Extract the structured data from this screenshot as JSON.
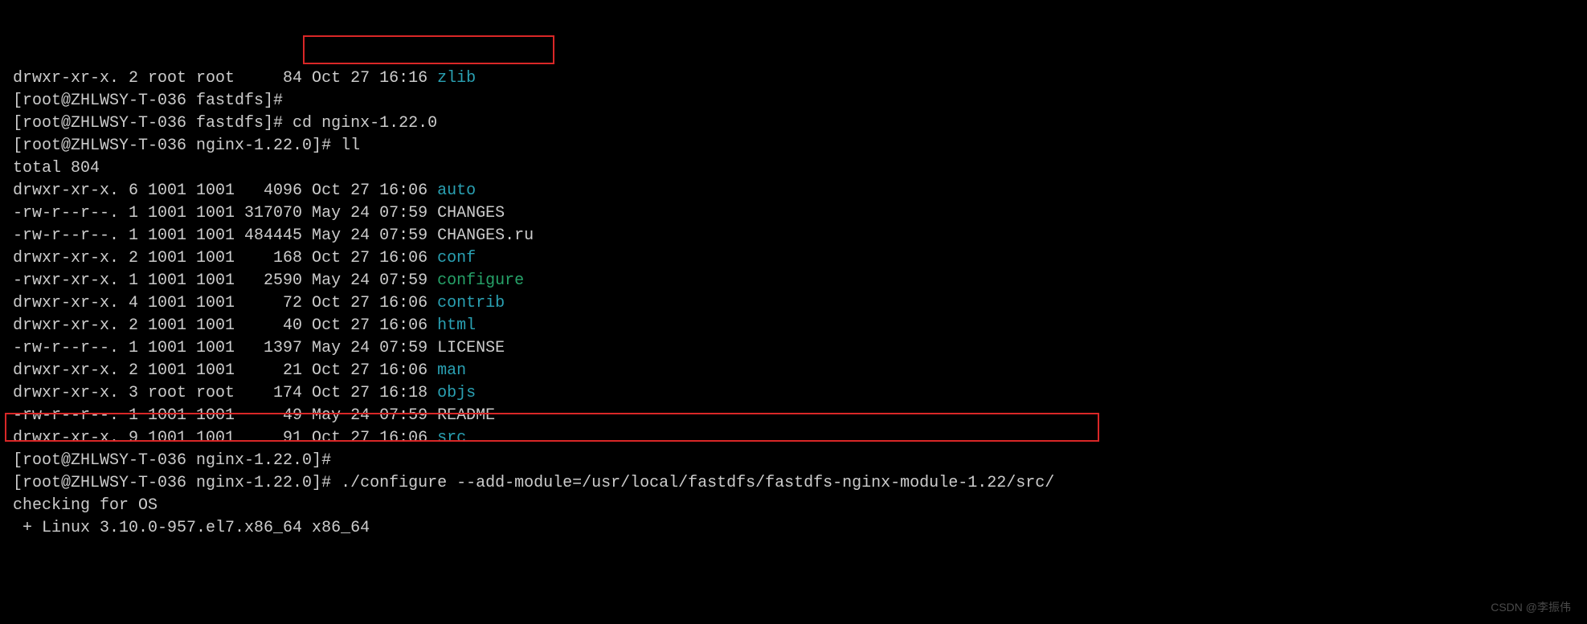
{
  "lines": [
    {
      "segments": [
        {
          "t": "drwxr-xr-x. 2 root root     84 Oct 27 16:16 ",
          "c": "white"
        },
        {
          "t": "zlib",
          "c": "cyan"
        }
      ]
    },
    {
      "segments": [
        {
          "t": "[root@ZHLWSY-T-036 fastdfs]# ",
          "c": "white"
        }
      ]
    },
    {
      "segments": [
        {
          "t": "[root@ZHLWSY-T-036 fastdfs]# cd nginx-1.22.0",
          "c": "white"
        }
      ]
    },
    {
      "segments": [
        {
          "t": "[root@ZHLWSY-T-036 nginx-1.22.0]# ll",
          "c": "white"
        }
      ]
    },
    {
      "segments": [
        {
          "t": "total 804",
          "c": "white"
        }
      ]
    },
    {
      "segments": [
        {
          "t": "drwxr-xr-x. 6 1001 1001   4096 Oct 27 16:06 ",
          "c": "white"
        },
        {
          "t": "auto",
          "c": "cyan"
        }
      ]
    },
    {
      "segments": [
        {
          "t": "-rw-r--r--. 1 1001 1001 317070 May 24 07:59 CHANGES",
          "c": "white"
        }
      ]
    },
    {
      "segments": [
        {
          "t": "-rw-r--r--. 1 1001 1001 484445 May 24 07:59 CHANGES.ru",
          "c": "white"
        }
      ]
    },
    {
      "segments": [
        {
          "t": "drwxr-xr-x. 2 1001 1001    168 Oct 27 16:06 ",
          "c": "white"
        },
        {
          "t": "conf",
          "c": "cyan"
        }
      ]
    },
    {
      "segments": [
        {
          "t": "-rwxr-xr-x. 1 1001 1001   2590 May 24 07:59 ",
          "c": "white"
        },
        {
          "t": "configure",
          "c": "green"
        }
      ]
    },
    {
      "segments": [
        {
          "t": "drwxr-xr-x. 4 1001 1001     72 Oct 27 16:06 ",
          "c": "white"
        },
        {
          "t": "contrib",
          "c": "cyan"
        }
      ]
    },
    {
      "segments": [
        {
          "t": "drwxr-xr-x. 2 1001 1001     40 Oct 27 16:06 ",
          "c": "white"
        },
        {
          "t": "html",
          "c": "cyan"
        }
      ]
    },
    {
      "segments": [
        {
          "t": "-rw-r--r--. 1 1001 1001   1397 May 24 07:59 LICENSE",
          "c": "white"
        }
      ]
    },
    {
      "segments": [
        {
          "t": "drwxr-xr-x. 2 1001 1001     21 Oct 27 16:06 ",
          "c": "white"
        },
        {
          "t": "man",
          "c": "cyan"
        }
      ]
    },
    {
      "segments": [
        {
          "t": "drwxr-xr-x. 3 root root    174 Oct 27 16:18 ",
          "c": "white"
        },
        {
          "t": "objs",
          "c": "cyan"
        }
      ]
    },
    {
      "segments": [
        {
          "t": "-rw-r--r--. 1 1001 1001     49 May 24 07:59 README",
          "c": "white"
        }
      ]
    },
    {
      "segments": [
        {
          "t": "drwxr-xr-x. 9 1001 1001     91 Oct 27 16:06 ",
          "c": "white"
        },
        {
          "t": "src",
          "c": "cyan"
        }
      ]
    },
    {
      "segments": [
        {
          "t": "[root@ZHLWSY-T-036 nginx-1.22.0]# ",
          "c": "white"
        }
      ]
    },
    {
      "segments": [
        {
          "t": "[root@ZHLWSY-T-036 nginx-1.22.0]# ./configure --add-module=/usr/local/fastdfs/fastdfs-nginx-module-1.22/src/",
          "c": "white"
        }
      ]
    },
    {
      "segments": [
        {
          "t": "checking for OS",
          "c": "white"
        }
      ]
    },
    {
      "segments": [
        {
          "t": " + Linux 3.10.0-957.el7.x86_64 x86_64",
          "c": "white"
        }
      ]
    }
  ],
  "watermark": "CSDN @李振伟"
}
